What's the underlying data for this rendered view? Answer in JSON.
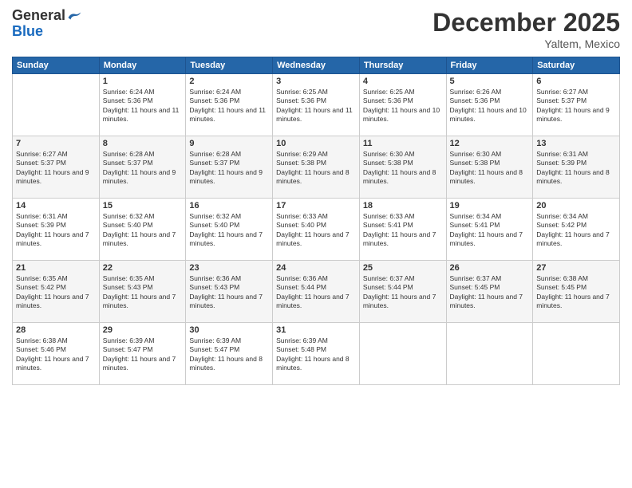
{
  "header": {
    "logo_general": "General",
    "logo_blue": "Blue",
    "month": "December 2025",
    "location": "Yaltem, Mexico"
  },
  "weekdays": [
    "Sunday",
    "Monday",
    "Tuesday",
    "Wednesday",
    "Thursday",
    "Friday",
    "Saturday"
  ],
  "weeks": [
    [
      {
        "day": "",
        "sunrise": "",
        "sunset": "",
        "daylight": ""
      },
      {
        "day": "1",
        "sunrise": "Sunrise: 6:24 AM",
        "sunset": "Sunset: 5:36 PM",
        "daylight": "Daylight: 11 hours and 11 minutes."
      },
      {
        "day": "2",
        "sunrise": "Sunrise: 6:24 AM",
        "sunset": "Sunset: 5:36 PM",
        "daylight": "Daylight: 11 hours and 11 minutes."
      },
      {
        "day": "3",
        "sunrise": "Sunrise: 6:25 AM",
        "sunset": "Sunset: 5:36 PM",
        "daylight": "Daylight: 11 hours and 11 minutes."
      },
      {
        "day": "4",
        "sunrise": "Sunrise: 6:25 AM",
        "sunset": "Sunset: 5:36 PM",
        "daylight": "Daylight: 11 hours and 10 minutes."
      },
      {
        "day": "5",
        "sunrise": "Sunrise: 6:26 AM",
        "sunset": "Sunset: 5:36 PM",
        "daylight": "Daylight: 11 hours and 10 minutes."
      },
      {
        "day": "6",
        "sunrise": "Sunrise: 6:27 AM",
        "sunset": "Sunset: 5:37 PM",
        "daylight": "Daylight: 11 hours and 9 minutes."
      }
    ],
    [
      {
        "day": "7",
        "sunrise": "Sunrise: 6:27 AM",
        "sunset": "Sunset: 5:37 PM",
        "daylight": "Daylight: 11 hours and 9 minutes."
      },
      {
        "day": "8",
        "sunrise": "Sunrise: 6:28 AM",
        "sunset": "Sunset: 5:37 PM",
        "daylight": "Daylight: 11 hours and 9 minutes."
      },
      {
        "day": "9",
        "sunrise": "Sunrise: 6:28 AM",
        "sunset": "Sunset: 5:37 PM",
        "daylight": "Daylight: 11 hours and 9 minutes."
      },
      {
        "day": "10",
        "sunrise": "Sunrise: 6:29 AM",
        "sunset": "Sunset: 5:38 PM",
        "daylight": "Daylight: 11 hours and 8 minutes."
      },
      {
        "day": "11",
        "sunrise": "Sunrise: 6:30 AM",
        "sunset": "Sunset: 5:38 PM",
        "daylight": "Daylight: 11 hours and 8 minutes."
      },
      {
        "day": "12",
        "sunrise": "Sunrise: 6:30 AM",
        "sunset": "Sunset: 5:38 PM",
        "daylight": "Daylight: 11 hours and 8 minutes."
      },
      {
        "day": "13",
        "sunrise": "Sunrise: 6:31 AM",
        "sunset": "Sunset: 5:39 PM",
        "daylight": "Daylight: 11 hours and 8 minutes."
      }
    ],
    [
      {
        "day": "14",
        "sunrise": "Sunrise: 6:31 AM",
        "sunset": "Sunset: 5:39 PM",
        "daylight": "Daylight: 11 hours and 7 minutes."
      },
      {
        "day": "15",
        "sunrise": "Sunrise: 6:32 AM",
        "sunset": "Sunset: 5:40 PM",
        "daylight": "Daylight: 11 hours and 7 minutes."
      },
      {
        "day": "16",
        "sunrise": "Sunrise: 6:32 AM",
        "sunset": "Sunset: 5:40 PM",
        "daylight": "Daylight: 11 hours and 7 minutes."
      },
      {
        "day": "17",
        "sunrise": "Sunrise: 6:33 AM",
        "sunset": "Sunset: 5:40 PM",
        "daylight": "Daylight: 11 hours and 7 minutes."
      },
      {
        "day": "18",
        "sunrise": "Sunrise: 6:33 AM",
        "sunset": "Sunset: 5:41 PM",
        "daylight": "Daylight: 11 hours and 7 minutes."
      },
      {
        "day": "19",
        "sunrise": "Sunrise: 6:34 AM",
        "sunset": "Sunset: 5:41 PM",
        "daylight": "Daylight: 11 hours and 7 minutes."
      },
      {
        "day": "20",
        "sunrise": "Sunrise: 6:34 AM",
        "sunset": "Sunset: 5:42 PM",
        "daylight": "Daylight: 11 hours and 7 minutes."
      }
    ],
    [
      {
        "day": "21",
        "sunrise": "Sunrise: 6:35 AM",
        "sunset": "Sunset: 5:42 PM",
        "daylight": "Daylight: 11 hours and 7 minutes."
      },
      {
        "day": "22",
        "sunrise": "Sunrise: 6:35 AM",
        "sunset": "Sunset: 5:43 PM",
        "daylight": "Daylight: 11 hours and 7 minutes."
      },
      {
        "day": "23",
        "sunrise": "Sunrise: 6:36 AM",
        "sunset": "Sunset: 5:43 PM",
        "daylight": "Daylight: 11 hours and 7 minutes."
      },
      {
        "day": "24",
        "sunrise": "Sunrise: 6:36 AM",
        "sunset": "Sunset: 5:44 PM",
        "daylight": "Daylight: 11 hours and 7 minutes."
      },
      {
        "day": "25",
        "sunrise": "Sunrise: 6:37 AM",
        "sunset": "Sunset: 5:44 PM",
        "daylight": "Daylight: 11 hours and 7 minutes."
      },
      {
        "day": "26",
        "sunrise": "Sunrise: 6:37 AM",
        "sunset": "Sunset: 5:45 PM",
        "daylight": "Daylight: 11 hours and 7 minutes."
      },
      {
        "day": "27",
        "sunrise": "Sunrise: 6:38 AM",
        "sunset": "Sunset: 5:45 PM",
        "daylight": "Daylight: 11 hours and 7 minutes."
      }
    ],
    [
      {
        "day": "28",
        "sunrise": "Sunrise: 6:38 AM",
        "sunset": "Sunset: 5:46 PM",
        "daylight": "Daylight: 11 hours and 7 minutes."
      },
      {
        "day": "29",
        "sunrise": "Sunrise: 6:39 AM",
        "sunset": "Sunset: 5:47 PM",
        "daylight": "Daylight: 11 hours and 7 minutes."
      },
      {
        "day": "30",
        "sunrise": "Sunrise: 6:39 AM",
        "sunset": "Sunset: 5:47 PM",
        "daylight": "Daylight: 11 hours and 8 minutes."
      },
      {
        "day": "31",
        "sunrise": "Sunrise: 6:39 AM",
        "sunset": "Sunset: 5:48 PM",
        "daylight": "Daylight: 11 hours and 8 minutes."
      },
      {
        "day": "",
        "sunrise": "",
        "sunset": "",
        "daylight": ""
      },
      {
        "day": "",
        "sunrise": "",
        "sunset": "",
        "daylight": ""
      },
      {
        "day": "",
        "sunrise": "",
        "sunset": "",
        "daylight": ""
      }
    ]
  ]
}
